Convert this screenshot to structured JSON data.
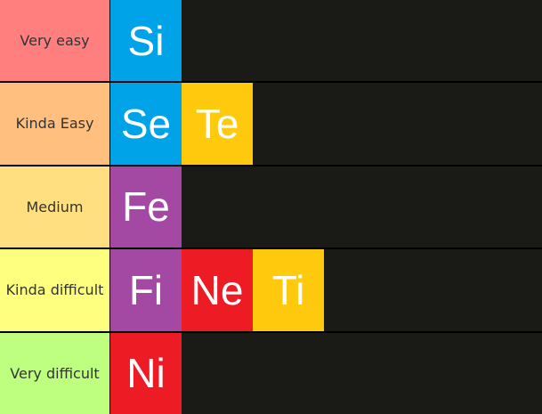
{
  "tiers": [
    {
      "label": "Very easy",
      "color": "#ff7f7f",
      "items": [
        {
          "text": "Si",
          "color": "#00a2e8"
        }
      ]
    },
    {
      "label": "Kinda Easy",
      "color": "#ffbf7f",
      "items": [
        {
          "text": "Se",
          "color": "#00a2e8"
        },
        {
          "text": "Te",
          "color": "#ffc90e"
        }
      ]
    },
    {
      "label": "Medium",
      "color": "#ffdf7f",
      "items": [
        {
          "text": "Fe",
          "color": "#a349a4"
        }
      ]
    },
    {
      "label": "Kinda difficult",
      "color": "#ffff7f",
      "items": [
        {
          "text": "Fi",
          "color": "#a349a4"
        },
        {
          "text": "Ne",
          "color": "#ed1c24"
        },
        {
          "text": "Ti",
          "color": "#ffc90e"
        }
      ]
    },
    {
      "label": "Very difficult",
      "color": "#bfff7f",
      "items": [
        {
          "text": "Ni",
          "color": "#ed1c24"
        }
      ]
    }
  ]
}
